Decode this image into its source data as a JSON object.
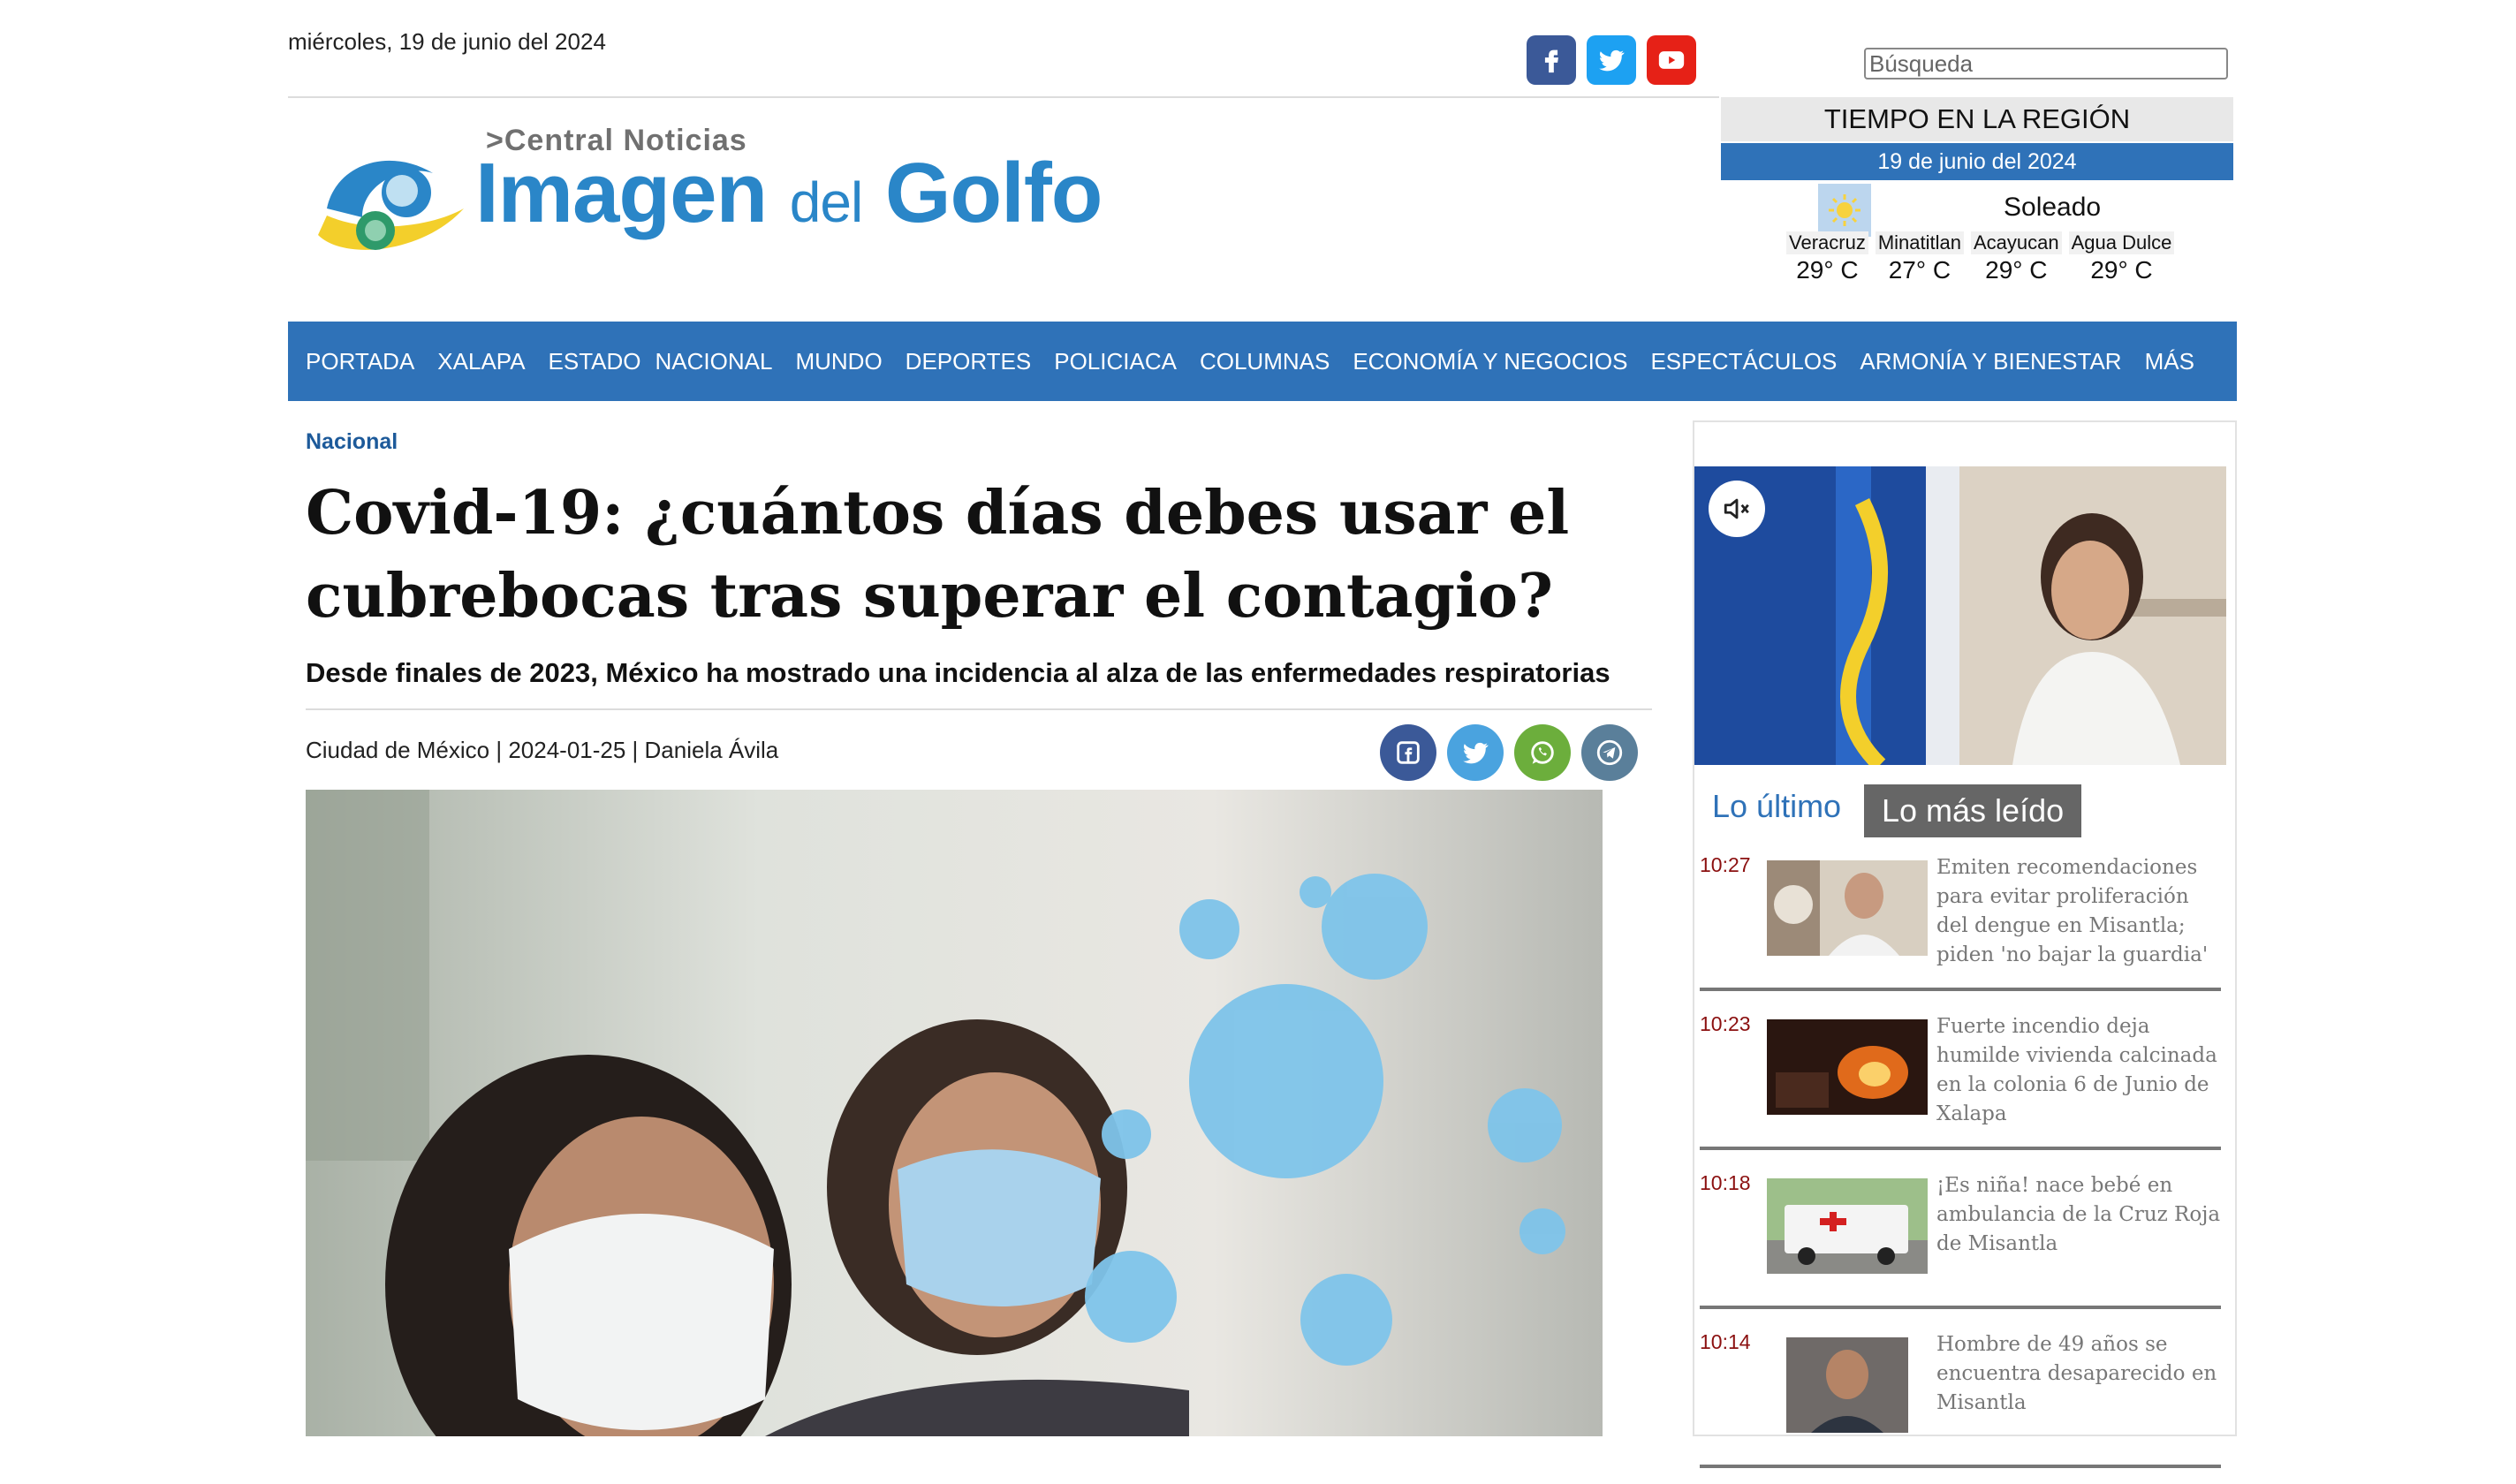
{
  "header": {
    "date": "miércoles, 19 de junio del 2024",
    "social": [
      {
        "name": "facebook-icon",
        "color": "#3b5998"
      },
      {
        "name": "twitter-icon",
        "color": "#1da1f2"
      },
      {
        "name": "youtube-icon",
        "color": "#e62117"
      }
    ],
    "search_placeholder": "Búsqueda"
  },
  "logo": {
    "small": "Central Noticias",
    "big_part1": "Imagen ",
    "big_part2": "del",
    "big_part3": " Golfo"
  },
  "weather": {
    "title": "TIEMPO EN LA REGIÓN",
    "date": "19 de junio del 2024",
    "condition": "Soleado",
    "cities": [
      {
        "name": "Veracruz",
        "temp": "29° C"
      },
      {
        "name": "Minatitlan",
        "temp": "27° C"
      },
      {
        "name": "Acayucan",
        "temp": "29° C"
      },
      {
        "name": "Agua Dulce",
        "temp": "29° C"
      }
    ]
  },
  "nav": [
    "PORTADA",
    "XALAPA",
    "ESTADO",
    "NACIONAL",
    "MUNDO",
    "DEPORTES",
    "POLICIACA",
    "COLUMNAS",
    "ECONOMÍA Y NEGOCIOS",
    "ESPECTÁCULOS",
    "ARMONÍA Y BIENESTAR",
    "MÁS"
  ],
  "article": {
    "category": "Nacional",
    "title": "Covid-19: ¿cuántos días debes usar el cubrebocas tras superar el contagio?",
    "subtitle": "Desde finales de 2023, México ha mostrado una incidencia al alza de las enfermedades respiratorias",
    "byline": "Ciudad de México | 2024-01-25 | Daniela Ávila",
    "share": [
      {
        "name": "facebook-share-icon",
        "color": "#3b5998"
      },
      {
        "name": "twitter-share-icon",
        "color": "#4aa3df"
      },
      {
        "name": "whatsapp-share-icon",
        "color": "#6cae3c"
      },
      {
        "name": "telegram-share-icon",
        "color": "#5a7f9a"
      }
    ]
  },
  "sidebar": {
    "tabs": {
      "latest": "Lo último",
      "most_read": "Lo más leído"
    },
    "news": [
      {
        "time": "10:27",
        "title": "Emiten recomendaciones para evitar proliferación del dengue en Misantla; piden 'no bajar la guardia'"
      },
      {
        "time": "10:23",
        "title": "Fuerte incendio deja humilde vivienda calcinada en la colonia 6 de Junio de Xalapa"
      },
      {
        "time": "10:18",
        "title": "¡Es niña! nace bebé en ambulancia de la Cruz Roja de Misantla"
      },
      {
        "time": "10:14",
        "title": "Hombre de 49 años se encuentra desaparecido en Misantla"
      }
    ]
  }
}
